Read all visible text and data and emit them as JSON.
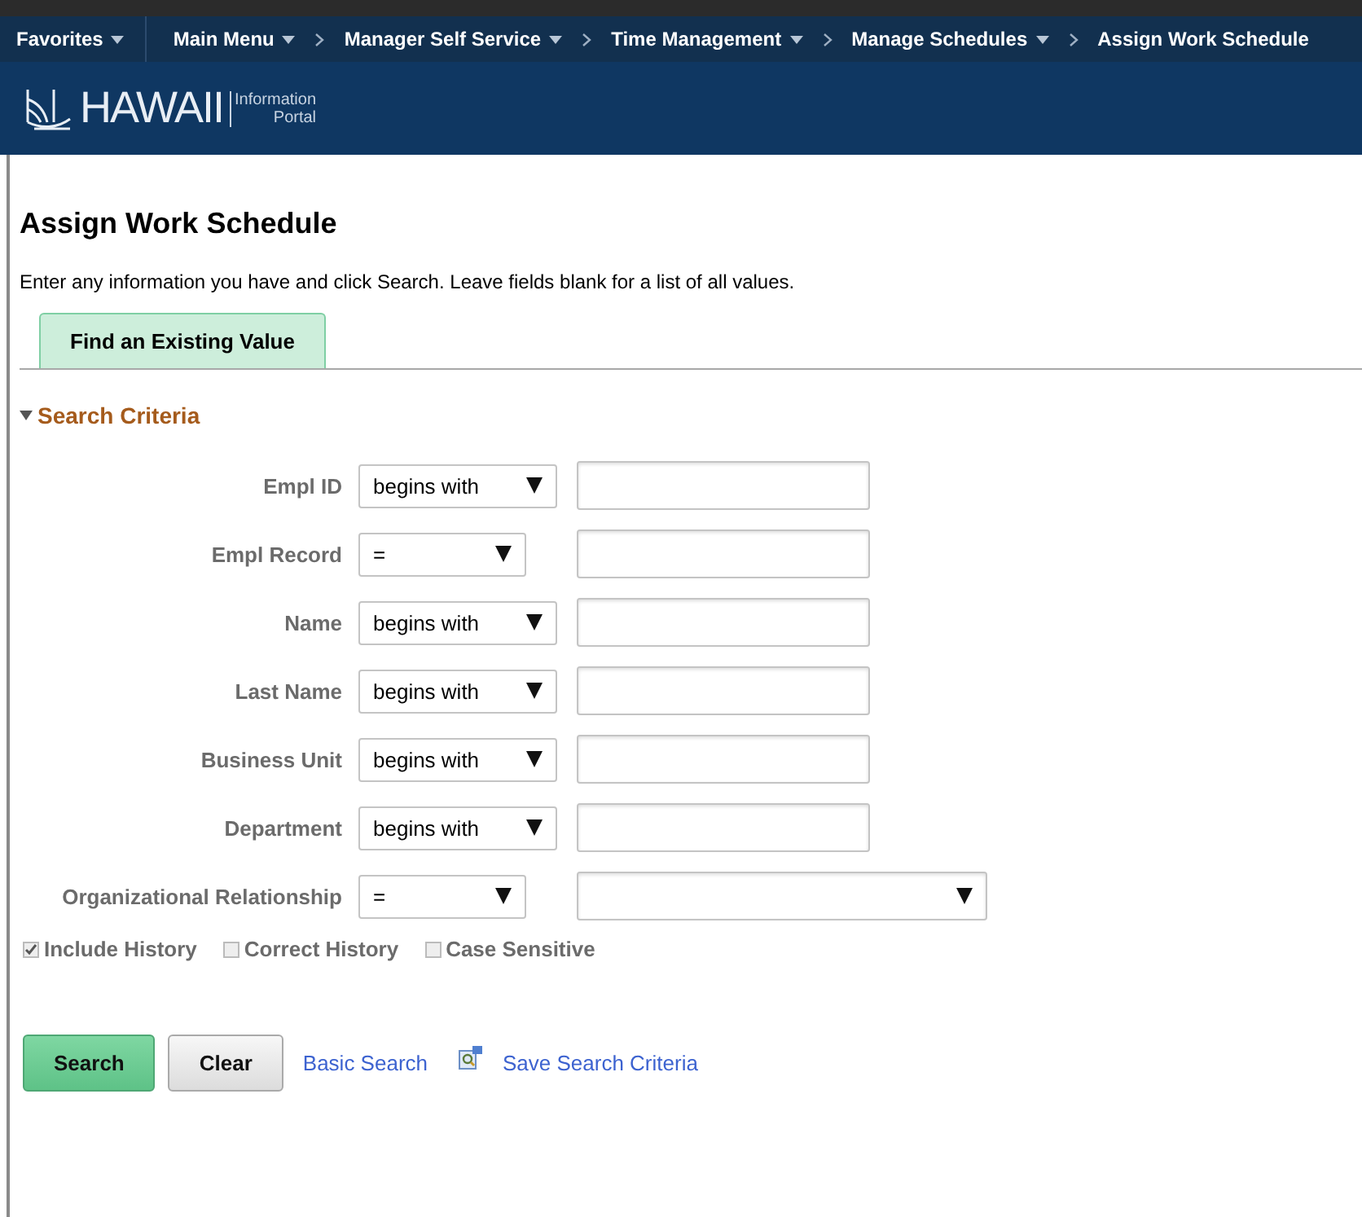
{
  "nav": [
    {
      "label": "Favorites",
      "has_menu": true
    },
    {
      "label": "Main Menu",
      "has_menu": true
    },
    {
      "label": "Manager Self Service",
      "has_menu": true
    },
    {
      "label": "Time Management",
      "has_menu": true
    },
    {
      "label": "Manage Schedules",
      "has_menu": true
    },
    {
      "label": "Assign Work Schedule",
      "has_menu": false
    }
  ],
  "banner": {
    "logo_text": "HAWAII",
    "logo_sub": [
      "Information",
      "Portal"
    ]
  },
  "page": {
    "title": "Assign Work Schedule",
    "instructions": "Enter any information you have and click Search. Leave fields blank for a list of all values."
  },
  "tabs": [
    {
      "label": "Find an Existing Value",
      "selected": true
    }
  ],
  "section": {
    "title": "Search Criteria",
    "expanded": true
  },
  "fields": [
    {
      "label": "Empl ID",
      "operator": "begins with",
      "kind": "text"
    },
    {
      "label": "Empl Record",
      "operator": "=",
      "kind": "text"
    },
    {
      "label": "Name",
      "operator": "begins with",
      "kind": "text"
    },
    {
      "label": "Last Name",
      "operator": "begins with",
      "kind": "text"
    },
    {
      "label": "Business Unit",
      "operator": "begins with",
      "kind": "text"
    },
    {
      "label": "Department",
      "operator": "begins with",
      "kind": "text"
    },
    {
      "label": "Organizational Relationship",
      "operator": "=",
      "kind": "select"
    }
  ],
  "options": [
    {
      "label": "Include History",
      "checked": true
    },
    {
      "label": "Correct History",
      "checked": false
    },
    {
      "label": "Case Sensitive",
      "checked": false
    }
  ],
  "buttons": [
    {
      "label": "Search",
      "kind": "primary"
    },
    {
      "label": "Clear",
      "kind": "secondary"
    }
  ],
  "links": [
    {
      "label": "Basic Search",
      "icon": false
    },
    {
      "label": "Save Search Criteria",
      "icon": true
    }
  ]
}
